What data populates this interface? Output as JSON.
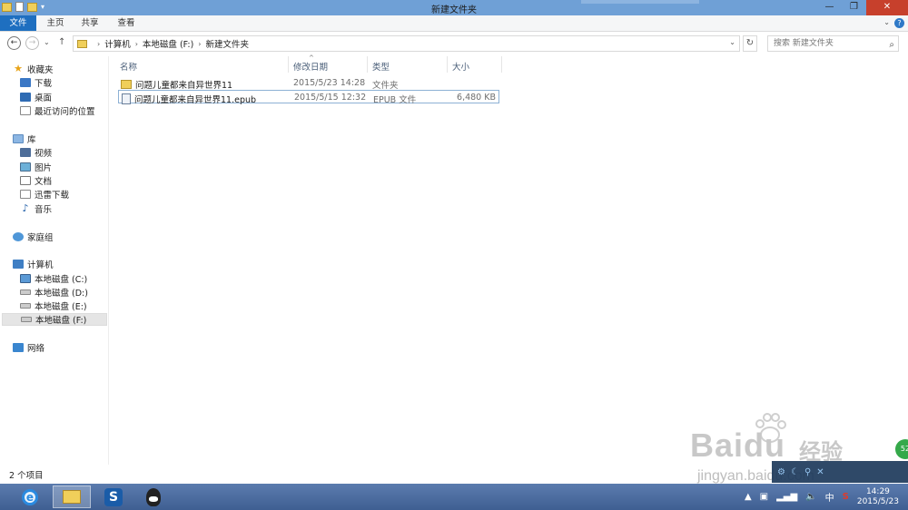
{
  "window": {
    "title": "新建文件夹",
    "controls": {
      "minimize": "—",
      "maximize": "❐",
      "close": "✕"
    }
  },
  "ribbon": {
    "tabs": [
      "文件",
      "主页",
      "共享",
      "查看"
    ]
  },
  "nav": {
    "back": "←",
    "forward": "→",
    "recent": "⌄",
    "up": "↑",
    "breadcrumb": [
      "计算机",
      "本地磁盘 (F:)",
      "新建文件夹"
    ],
    "search_placeholder": "搜索 新建文件夹"
  },
  "sidebar": {
    "items": [
      {
        "label": "收藏夹",
        "icon": "star-icon"
      },
      {
        "label": "下载",
        "icon": "downloads-icon"
      },
      {
        "label": "桌面",
        "icon": "desktop-icon"
      },
      {
        "label": "最近访问的位置",
        "icon": "recent-places-icon"
      },
      {
        "label": "库",
        "icon": "library-icon"
      },
      {
        "label": "视频",
        "icon": "videos-icon"
      },
      {
        "label": "图片",
        "icon": "pictures-icon"
      },
      {
        "label": "文档",
        "icon": "documents-icon"
      },
      {
        "label": "迅雷下载",
        "icon": "thunder-download-icon"
      },
      {
        "label": "音乐",
        "icon": "music-icon"
      },
      {
        "label": "家庭组",
        "icon": "homegroup-icon"
      },
      {
        "label": "计算机",
        "icon": "computer-icon"
      },
      {
        "label": "本地磁盘 (C:)",
        "icon": "drive-icon"
      },
      {
        "label": "本地磁盘 (D:)",
        "icon": "drive-icon"
      },
      {
        "label": "本地磁盘 (E:)",
        "icon": "drive-icon"
      },
      {
        "label": "本地磁盘 (F:)",
        "icon": "drive-icon",
        "selected": true
      },
      {
        "label": "网络",
        "icon": "network-icon"
      }
    ]
  },
  "files": {
    "columns": [
      "名称",
      "修改日期",
      "类型",
      "大小"
    ],
    "rows": [
      {
        "name": "问题儿童都来自异世界11",
        "date": "2015/5/23 14:28",
        "type": "文件夹",
        "size": "",
        "icon": "folder-icon"
      },
      {
        "name": "问题儿童都来自异世界11.epub",
        "date": "2015/5/15 12:32",
        "type": "EPUB 文件",
        "size": "6,480 KB",
        "icon": "epub-file-icon",
        "selected": true
      }
    ]
  },
  "status": {
    "item_count": "2 个项目"
  },
  "watermark": {
    "logo": "Baidu",
    "jingyan": "经验",
    "url": "jingyan.baidu.com"
  },
  "taskbar": {
    "apps": [
      "internet-explorer-icon",
      "file-explorer-icon",
      "sogou-icon",
      "qq-icon"
    ],
    "ime": "中",
    "time": "14:29",
    "date": "2015/5/23"
  },
  "colors": {
    "titlebar": "#6fa0d6",
    "file_tab": "#1e6fc0",
    "close_button": "#c7402c",
    "selection_border": "#8db1d5"
  }
}
